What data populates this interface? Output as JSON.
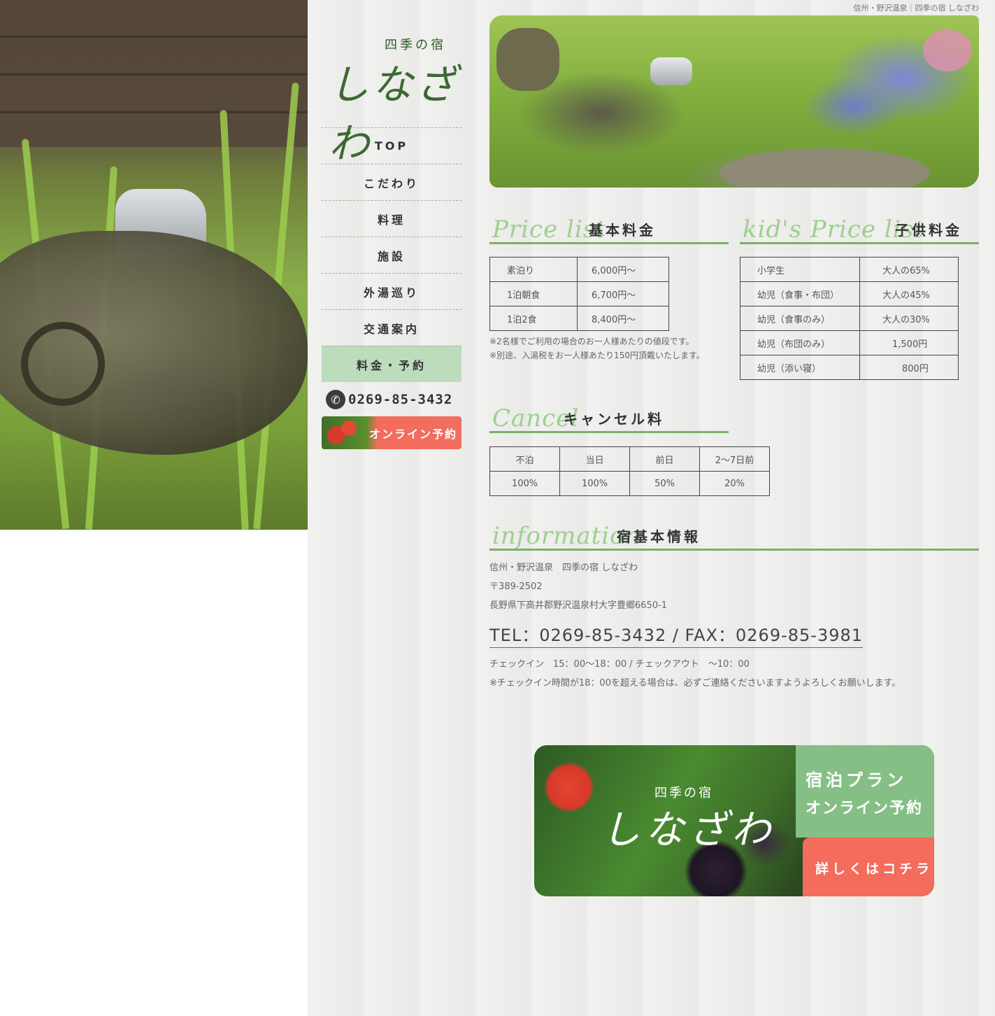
{
  "breadcrumb": "信州・野沢温泉｜四季の宿 しなざわ",
  "logo": {
    "small": "四季の宿",
    "big": "しなざわ"
  },
  "nav": {
    "items": [
      "TOP",
      "こだわり",
      "料理",
      "施設",
      "外湯巡り",
      "交通案内",
      "料金・予約"
    ],
    "active_index": 6,
    "phone": "0269-85-3432",
    "reserve_label": "オンライン予約"
  },
  "price": {
    "heading_en": "Price list",
    "heading_ja": "基本料金",
    "rows": [
      {
        "label": "素泊り",
        "value": "6,000円〜"
      },
      {
        "label": "1泊朝食",
        "value": "6,700円〜"
      },
      {
        "label": "1泊2食",
        "value": "8,400円〜"
      }
    ],
    "notes": [
      "※2名様でご利用の場合のお一人様あたりの値段です。",
      "※別途、入湯税をお一人様あたり150円頂戴いたします。"
    ]
  },
  "kids": {
    "heading_en": "kid's Price list",
    "heading_ja": "子供料金",
    "rows": [
      {
        "label": "小学生",
        "value": "大人の65%"
      },
      {
        "label": "幼児（食事・布団）",
        "value": "大人の45%"
      },
      {
        "label": "幼児（食事のみ）",
        "value": "大人の30%"
      },
      {
        "label": "幼児（布団のみ）",
        "value": "1,500円"
      },
      {
        "label": "幼児（添い寝）",
        "value": "800円"
      }
    ]
  },
  "cancel": {
    "heading_en": "Cancel",
    "heading_ja": "キャンセル料",
    "headers": [
      "不泊",
      "当日",
      "前日",
      "2〜7日前"
    ],
    "values": [
      "100%",
      "100%",
      "50%",
      "20%"
    ]
  },
  "info": {
    "heading_en": "information",
    "heading_ja": "宿基本情報",
    "name": "信州・野沢温泉　四季の宿 しなざわ",
    "zip": "〒389-2502",
    "address": "長野県下高井郡野沢温泉村大字豊郷6650-1",
    "tel_fax": "TEL：0269-85-3432 / FAX：0269-85-3981",
    "checkin": "チェックイン　15：00〜18：00 / チェックアウト　〜10：00",
    "checkin_note": "※チェックイン時間が18：00を超える場合は、必ずご連絡くださいますようよろしくお願いします。"
  },
  "banner": {
    "logo_small": "四季の宿",
    "logo_big": "しなざわ",
    "line1": "宿泊プラン",
    "line2": "オンライン予約",
    "detail": "詳しくはコチラ"
  },
  "colors": {
    "accent_green": "#7bb068",
    "nav_active": "#bcdcbc",
    "reserve_red": "#f36c5c",
    "heading_en": "#9cd08e"
  }
}
